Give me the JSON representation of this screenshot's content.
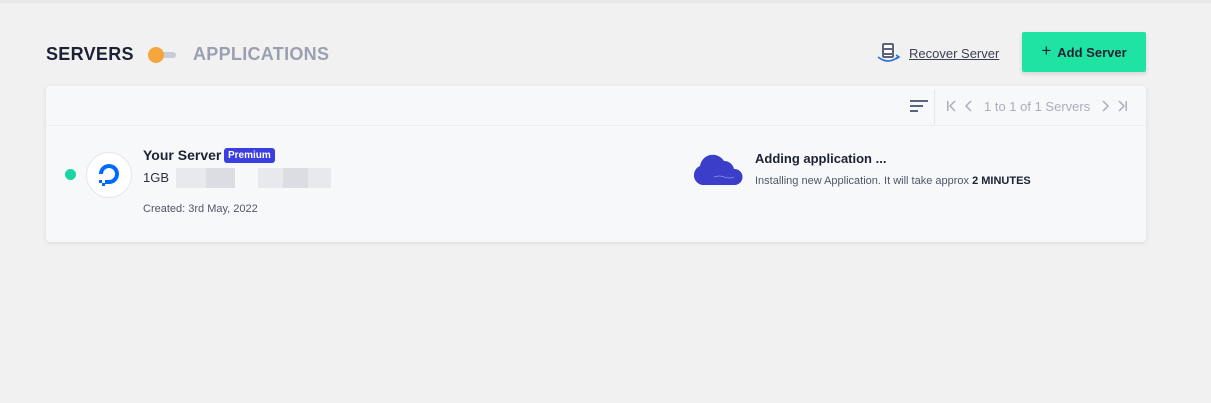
{
  "header": {
    "servers_tab": "SERVERS",
    "applications_tab": "APPLICATIONS",
    "recover_label": "Recover Server",
    "add_label": "Add Server",
    "toggle_color": "#f4a53b",
    "accent": "#1fe3a3"
  },
  "toolbar": {
    "pagination_text": "1 to 1 of 1 Servers"
  },
  "server": {
    "status_color": "#19d6a0",
    "provider_icon": "digitalocean-logo",
    "name": "Your Server",
    "badge": "Premium",
    "size": "1GB",
    "created": "Created: 3rd May, 2022"
  },
  "progress": {
    "title": "Adding application ...",
    "description": "Installing new Application. It will take approx",
    "duration": "2 MINUTES"
  }
}
